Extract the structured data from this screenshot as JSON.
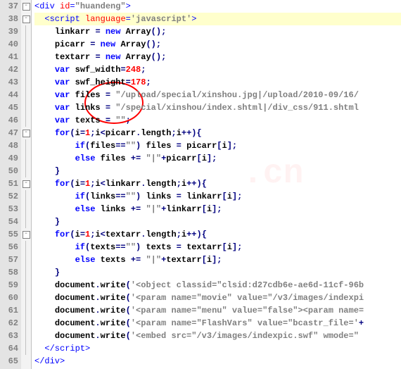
{
  "lines": [
    {
      "n": "37",
      "fold": "minus",
      "cls": "",
      "html": "<span class='tag'>&lt;div</span> <span class='attr'>id</span><span class='tag'>=</span><span class='str'>\"huandeng\"</span><span class='tag'>&gt;</span>"
    },
    {
      "n": "38",
      "fold": "minus",
      "cls": "hl",
      "html": "&nbsp;&nbsp;<span class='tag'>&lt;script</span> <span class='attr'>language</span><span class='tag'>=</span><span class='str'>'javascript'</span><span class='tag'>&gt;</span>"
    },
    {
      "n": "39",
      "fold": "line",
      "cls": "",
      "html": "&nbsp;&nbsp;&nbsp;&nbsp;<span class='txt'>linkarr</span> <span class='op'>=</span> <span class='kw'>new</span> <span class='fn'>Array</span><span class='op'>();</span>"
    },
    {
      "n": "40",
      "fold": "line",
      "cls": "",
      "html": "&nbsp;&nbsp;&nbsp;&nbsp;<span class='txt'>picarr</span> <span class='op'>=</span> <span class='kw'>new</span> <span class='fn'>Array</span><span class='op'>();</span>"
    },
    {
      "n": "41",
      "fold": "line",
      "cls": "",
      "html": "&nbsp;&nbsp;&nbsp;&nbsp;<span class='txt'>textarr</span> <span class='op'>=</span> <span class='kw'>new</span> <span class='fn'>Array</span><span class='op'>();</span>"
    },
    {
      "n": "42",
      "fold": "line",
      "cls": "",
      "html": "&nbsp;&nbsp;&nbsp;&nbsp;<span class='kw'>var</span> <span class='txt'>swf_width</span><span class='op'>=</span><span class='num'>248</span><span class='op'>;</span>"
    },
    {
      "n": "43",
      "fold": "line",
      "cls": "",
      "html": "&nbsp;&nbsp;&nbsp;&nbsp;<span class='kw'>var</span> <span class='txt'>swf_height</span><span class='op'>=</span><span class='num'>178</span><span class='op'>;</span>"
    },
    {
      "n": "44",
      "fold": "line",
      "cls": "",
      "html": "&nbsp;&nbsp;&nbsp;&nbsp;<span class='kw'>var</span> <span class='txt'>files</span> <span class='op'>=</span> <span class='str'>\"/upload/special/xinshou.jpg|/upload/2010-09/16/</span>"
    },
    {
      "n": "45",
      "fold": "line",
      "cls": "",
      "html": "&nbsp;&nbsp;&nbsp;&nbsp;<span class='kw'>var</span> <span class='txt'>links</span> <span class='op'>=</span> <span class='str'>\"/special/xinshou/index.shtml|/div_css/911.shtml</span>"
    },
    {
      "n": "46",
      "fold": "line",
      "cls": "",
      "html": "&nbsp;&nbsp;&nbsp;&nbsp;<span class='kw'>var</span> <span class='txt'>texts</span> <span class='op'>=</span> <span class='str'>\"\"</span><span class='op'>;</span>"
    },
    {
      "n": "47",
      "fold": "minus",
      "cls": "",
      "html": "&nbsp;&nbsp;&nbsp;&nbsp;<span class='kw'>for</span><span class='op'>(</span><span class='txt'>i</span><span class='op'>=</span><span class='num'>1</span><span class='op'>;</span><span class='txt'>i</span><span class='op'>&lt;</span><span class='txt'>picarr</span><span class='op'>.</span><span class='txt'>length</span><span class='op'>;</span><span class='txt'>i</span><span class='op'>++){</span>"
    },
    {
      "n": "48",
      "fold": "line",
      "cls": "",
      "html": "&nbsp;&nbsp;&nbsp;&nbsp;&nbsp;&nbsp;&nbsp;&nbsp;<span class='kw'>if</span><span class='op'>(</span><span class='txt'>files</span><span class='op'>==</span><span class='str'>\"\"</span><span class='op'>)</span> <span class='txt'>files</span> <span class='op'>=</span> <span class='txt'>picarr</span><span class='op'>[</span><span class='txt'>i</span><span class='op'>];</span>"
    },
    {
      "n": "49",
      "fold": "line",
      "cls": "",
      "html": "&nbsp;&nbsp;&nbsp;&nbsp;&nbsp;&nbsp;&nbsp;&nbsp;<span class='kw'>else</span> <span class='txt'>files</span> <span class='op'>+=</span> <span class='str'>\"|\"</span><span class='op'>+</span><span class='txt'>picarr</span><span class='op'>[</span><span class='txt'>i</span><span class='op'>];</span>"
    },
    {
      "n": "50",
      "fold": "line",
      "cls": "",
      "html": "&nbsp;&nbsp;&nbsp;&nbsp;<span class='op'>}</span>"
    },
    {
      "n": "51",
      "fold": "minus",
      "cls": "",
      "html": "&nbsp;&nbsp;&nbsp;&nbsp;<span class='kw'>for</span><span class='op'>(</span><span class='txt'>i</span><span class='op'>=</span><span class='num'>1</span><span class='op'>;</span><span class='txt'>i</span><span class='op'>&lt;</span><span class='txt'>linkarr</span><span class='op'>.</span><span class='txt'>length</span><span class='op'>;</span><span class='txt'>i</span><span class='op'>++){</span>"
    },
    {
      "n": "52",
      "fold": "line",
      "cls": "",
      "html": "&nbsp;&nbsp;&nbsp;&nbsp;&nbsp;&nbsp;&nbsp;&nbsp;<span class='kw'>if</span><span class='op'>(</span><span class='txt'>links</span><span class='op'>==</span><span class='str'>\"\"</span><span class='op'>)</span> <span class='txt'>links</span> <span class='op'>=</span> <span class='txt'>linkarr</span><span class='op'>[</span><span class='txt'>i</span><span class='op'>];</span>"
    },
    {
      "n": "53",
      "fold": "line",
      "cls": "",
      "html": "&nbsp;&nbsp;&nbsp;&nbsp;&nbsp;&nbsp;&nbsp;&nbsp;<span class='kw'>else</span> <span class='txt'>links</span> <span class='op'>+=</span> <span class='str'>\"|\"</span><span class='op'>+</span><span class='txt'>linkarr</span><span class='op'>[</span><span class='txt'>i</span><span class='op'>];</span>"
    },
    {
      "n": "54",
      "fold": "line",
      "cls": "",
      "html": "&nbsp;&nbsp;&nbsp;&nbsp;<span class='op'>}</span>"
    },
    {
      "n": "55",
      "fold": "minus",
      "cls": "",
      "html": "&nbsp;&nbsp;&nbsp;&nbsp;<span class='kw'>for</span><span class='op'>(</span><span class='txt'>i</span><span class='op'>=</span><span class='num'>1</span><span class='op'>;</span><span class='txt'>i</span><span class='op'>&lt;</span><span class='txt'>textarr</span><span class='op'>.</span><span class='txt'>length</span><span class='op'>;</span><span class='txt'>i</span><span class='op'>++){</span>"
    },
    {
      "n": "56",
      "fold": "line",
      "cls": "",
      "html": "&nbsp;&nbsp;&nbsp;&nbsp;&nbsp;&nbsp;&nbsp;&nbsp;<span class='kw'>if</span><span class='op'>(</span><span class='txt'>texts</span><span class='op'>==</span><span class='str'>\"\"</span><span class='op'>)</span> <span class='txt'>texts</span> <span class='op'>=</span> <span class='txt'>textarr</span><span class='op'>[</span><span class='txt'>i</span><span class='op'>];</span>"
    },
    {
      "n": "57",
      "fold": "line",
      "cls": "",
      "html": "&nbsp;&nbsp;&nbsp;&nbsp;&nbsp;&nbsp;&nbsp;&nbsp;<span class='kw'>else</span> <span class='txt'>texts</span> <span class='op'>+=</span> <span class='str'>\"|\"</span><span class='op'>+</span><span class='txt'>textarr</span><span class='op'>[</span><span class='txt'>i</span><span class='op'>];</span>"
    },
    {
      "n": "58",
      "fold": "line",
      "cls": "",
      "html": "&nbsp;&nbsp;&nbsp;&nbsp;<span class='op'>}</span>"
    },
    {
      "n": "59",
      "fold": "line",
      "cls": "",
      "html": "&nbsp;&nbsp;&nbsp;&nbsp;<span class='txt'>document</span><span class='op'>.</span><span class='fn'>write</span><span class='op'>(</span><span class='str'>'&lt;object classid=\"clsid:d27cdb6e-ae6d-11cf-96b</span>"
    },
    {
      "n": "60",
      "fold": "line",
      "cls": "",
      "html": "&nbsp;&nbsp;&nbsp;&nbsp;<span class='txt'>document</span><span class='op'>.</span><span class='fn'>write</span><span class='op'>(</span><span class='str'>'&lt;param name=\"movie\" value=\"/v3/images/indexpi</span>"
    },
    {
      "n": "61",
      "fold": "line",
      "cls": "",
      "html": "&nbsp;&nbsp;&nbsp;&nbsp;<span class='txt'>document</span><span class='op'>.</span><span class='fn'>write</span><span class='op'>(</span><span class='str'>'&lt;param name=\"menu\" value=\"false\"&gt;&lt;param name=</span>"
    },
    {
      "n": "62",
      "fold": "line",
      "cls": "",
      "html": "&nbsp;&nbsp;&nbsp;&nbsp;<span class='txt'>document</span><span class='op'>.</span><span class='fn'>write</span><span class='op'>(</span><span class='str'>'&lt;param name=\"FlashVars\" value=\"bcastr_file='</span><span class='op'>+</span>"
    },
    {
      "n": "63",
      "fold": "line",
      "cls": "",
      "html": "&nbsp;&nbsp;&nbsp;&nbsp;<span class='txt'>document</span><span class='op'>.</span><span class='fn'>write</span><span class='op'>(</span><span class='str'>'&lt;embed src=\"/v3/images/indexpic.swf\" wmode=\"</span>"
    },
    {
      "n": "64",
      "fold": "line",
      "cls": "",
      "html": "&nbsp;&nbsp;<span class='tag'>&lt;/script&gt;</span>"
    },
    {
      "n": "65",
      "fold": "",
      "cls": "",
      "html": "<span class='tag'>&lt;/div&gt;</span>"
    }
  ]
}
